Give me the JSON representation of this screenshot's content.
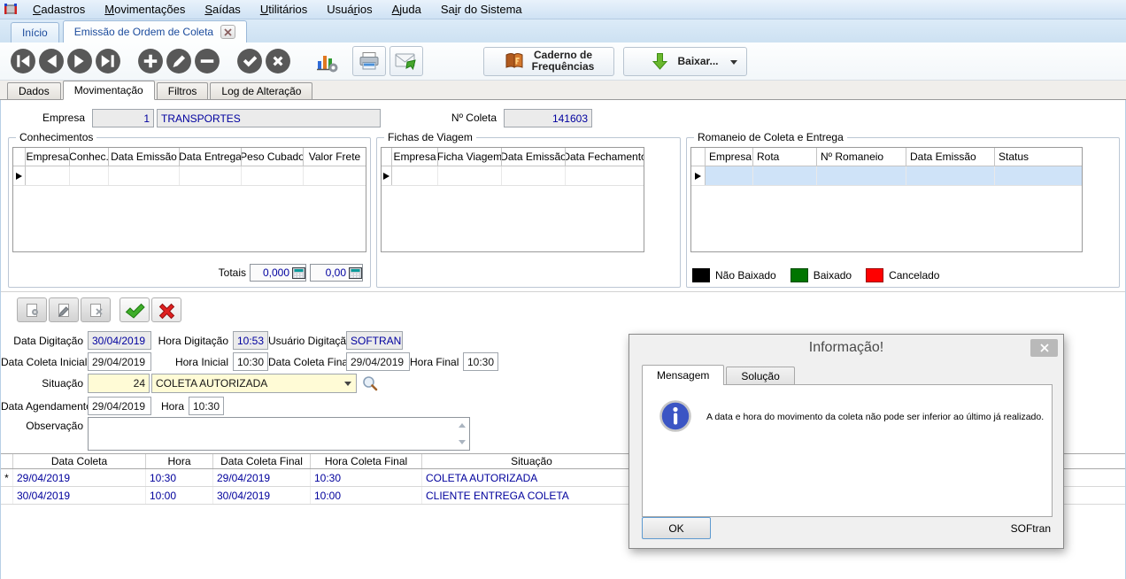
{
  "menu": {
    "items": [
      {
        "pre": "",
        "key": "C",
        "post": "adastros"
      },
      {
        "pre": "",
        "key": "M",
        "post": "ovimentações"
      },
      {
        "pre": "",
        "key": "S",
        "post": "aídas"
      },
      {
        "pre": "",
        "key": "U",
        "post": "tilitários"
      },
      {
        "pre": "Usuá",
        "key": "r",
        "post": "ios"
      },
      {
        "pre": "",
        "key": "A",
        "post": "juda"
      },
      {
        "pre": "Sa",
        "key": "i",
        "post": "r do Sistema"
      }
    ]
  },
  "window_tabs": {
    "inicio": "Início",
    "emissao": "Emissão de Ordem de Coleta"
  },
  "toolbar": {
    "caderno_line1": "Caderno de",
    "caderno_line2": "Frequências",
    "baixar": "Baixar..."
  },
  "subtabs": {
    "dados": "Dados",
    "movimentacao": "Movimentação",
    "filtros": "Filtros",
    "log": "Log de Alteração"
  },
  "header": {
    "empresa_label": "Empresa",
    "empresa_code": "1",
    "empresa_name": "TRANSPORTES",
    "ncoleta_label": "Nº Coleta",
    "ncoleta_value": "141603"
  },
  "conhecimentos": {
    "title": "Conhecimentos",
    "columns": [
      "Empresa",
      "Conhec.",
      "Data Emissão",
      "Data Entrega",
      "Peso Cubado",
      "Valor Frete"
    ],
    "totais_label": "Totais",
    "total_peso": "0,000",
    "total_frete": "0,00"
  },
  "fichas": {
    "title": "Fichas de Viagem",
    "columns": [
      "Empresa",
      "Ficha Viagem",
      "Data Emissão",
      "Data Fechamento"
    ]
  },
  "romaneio": {
    "title": "Romaneio de Coleta e Entrega",
    "columns": [
      "Empresa",
      "Rota",
      "Nº Romaneio",
      "Data Emissão",
      "Status"
    ],
    "legend": [
      {
        "label": "Não Baixado",
        "color": "#000000"
      },
      {
        "label": "Baixado",
        "color": "#007500"
      },
      {
        "label": "Cancelado",
        "color": "#fe0000"
      }
    ]
  },
  "form": {
    "data_digitacao_label": "Data Digitação",
    "data_digitacao": "30/04/2019",
    "hora_digitacao_label": "Hora Digitação",
    "hora_digitacao": "10:53",
    "usuario_digitacao_label": "Usuário Digitação",
    "usuario_digitacao": "SOFTRAN",
    "data_coleta_inicial_label": "Data Coleta Inicial",
    "data_coleta_inicial": "29/04/2019",
    "hora_inicial_label": "Hora Inicial",
    "hora_inicial": "10:30",
    "data_coleta_final_label": "Data Coleta Final",
    "data_coleta_final": "29/04/2019",
    "hora_final_label": "Hora Final",
    "hora_final": "10:30",
    "situacao_label": "Situação",
    "situacao_code": "24",
    "situacao_desc": "COLETA AUTORIZADA",
    "data_agendamento_label": "Data Agendamento",
    "data_agendamento": "29/04/2019",
    "hora_agendamento_label": "Hora",
    "hora_agendamento": "10:30",
    "observacao_label": "Observação",
    "observacao": ""
  },
  "movements": {
    "columns": [
      "Data Coleta",
      "Hora",
      "Data Coleta Final",
      "Hora Coleta Final",
      "Situação"
    ],
    "rows": [
      {
        "marker": "*",
        "cells": [
          "29/04/2019",
          "10:30",
          "29/04/2019",
          "10:30",
          "COLETA AUTORIZADA"
        ]
      },
      {
        "marker": "",
        "cells": [
          "30/04/2019",
          "10:00",
          "30/04/2019",
          "10:00",
          "CLIENTE ENTREGA COLETA"
        ]
      }
    ]
  },
  "dialog": {
    "title": "Informação!",
    "tab_mensagem": "Mensagem",
    "tab_solucao": "Solução",
    "message": "A data e hora do movimento da coleta não pode ser inferior ao último já realizado.",
    "ok": "OK",
    "brand": "SOFtran"
  },
  "colors": {
    "accent_navy": "#00009f",
    "highlight_row": "#cfe3f8",
    "field_yellow": "#fffbd6"
  }
}
